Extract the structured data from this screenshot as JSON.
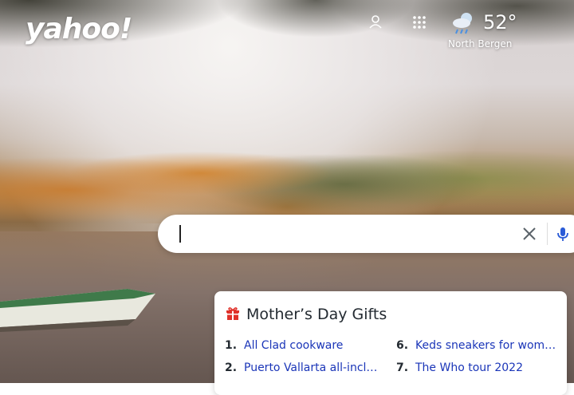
{
  "header": {
    "logo_text": "yahoo!",
    "icons": [
      "profile-icon",
      "apps-grid-icon"
    ]
  },
  "weather": {
    "icon": "rain-cloud-icon",
    "temperature": "52°",
    "location": "North Bergen"
  },
  "search": {
    "value": "",
    "placeholder": "",
    "clear_icon": "close-icon",
    "voice_icon": "microphone-icon"
  },
  "trending": {
    "icon": "gift-icon",
    "title": "Mother’s Day Gifts",
    "items": [
      {
        "num": "1.",
        "text": "All Clad cookware"
      },
      {
        "num": "2.",
        "text": "Puerto Vallarta all-incl…"
      },
      {
        "num": "6.",
        "text": "Keds sneakers for wom…"
      },
      {
        "num": "7.",
        "text": "The Who tour 2022"
      }
    ]
  },
  "colors": {
    "link": "#1a35b8",
    "text": "#232a31",
    "gift_red": "#e0322b"
  }
}
